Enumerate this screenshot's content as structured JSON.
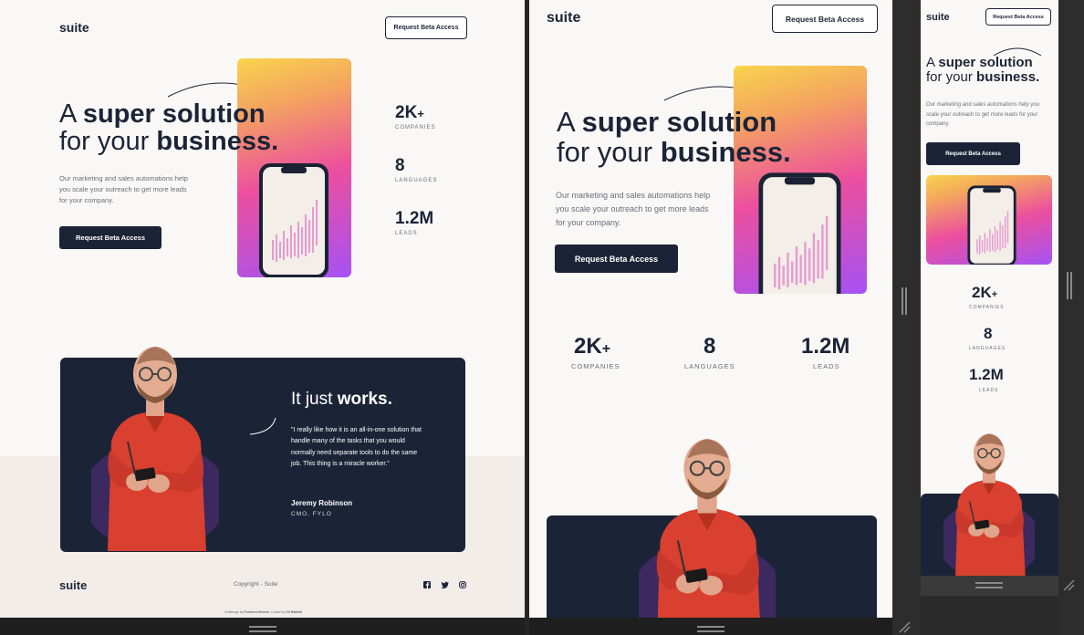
{
  "brand": "suite",
  "cta_label": "Request Beta Access",
  "hero": {
    "title_prefix": "A ",
    "title_bold": "super solution",
    "title_line2_prefix": "for your ",
    "title_line2_bold": "business.",
    "description": "Our marketing and sales automations help you scale your outreach to get more leads for your company."
  },
  "stats": [
    {
      "value": "2K",
      "suffix": "+",
      "label": "COMPANIES"
    },
    {
      "value": "8",
      "suffix": "",
      "label": "LANGUAGES"
    },
    {
      "value": "1.2M",
      "suffix": "",
      "label": "LEADS"
    }
  ],
  "testimonial": {
    "heading_prefix": "It just ",
    "heading_bold": "works.",
    "quote": "\"I really like how it is an all-in-one solution that handle many of the tasks that you would normally need separate tools to do the same job. This thing is a miracle worker.\"",
    "name": "Jeremy Robinson",
    "role": "CMO, FYLO"
  },
  "footer": {
    "copyright": "Copyright - Suite",
    "credit_prefix": "Challenge by",
    "credit_source": "Frontend Mentor",
    "credit_mid": ". Coded by",
    "credit_author": "Gil Rafaelli"
  },
  "colors": {
    "navy": "#1b2437",
    "shirt": "#d9402f",
    "gradient": [
      "#f8d44c",
      "#ec4f9e",
      "#a552f5"
    ]
  },
  "icons": [
    "facebook-icon",
    "twitter-icon",
    "instagram-icon"
  ]
}
